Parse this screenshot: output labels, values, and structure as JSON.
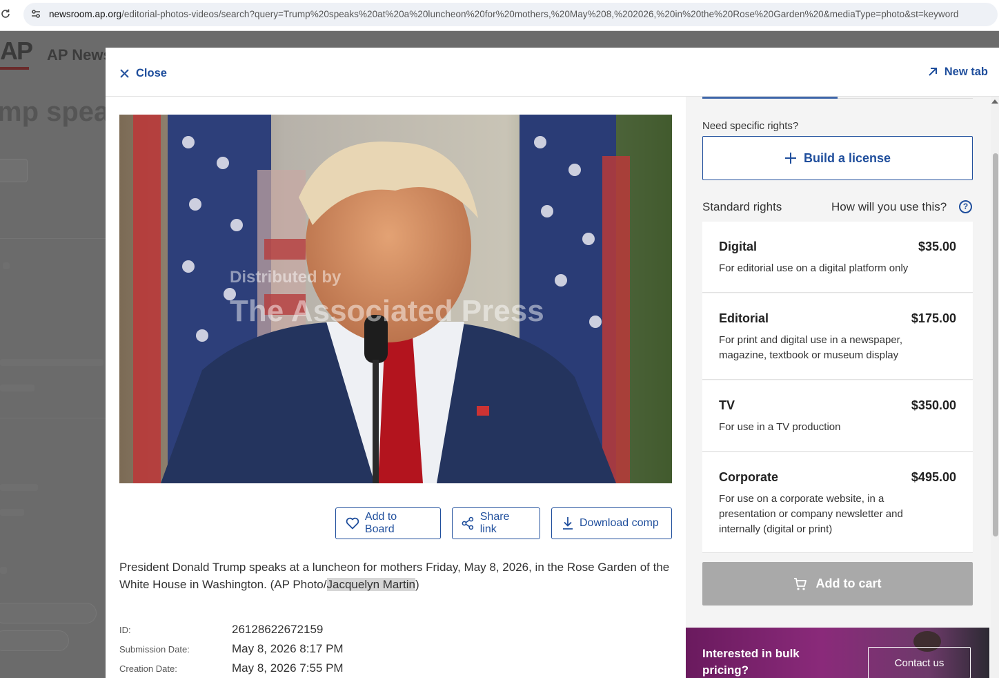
{
  "browser": {
    "url_host": "newsroom.ap.org",
    "url_path": "/editorial-photos-videos/search?query=Trump%20speaks%20at%20a%20luncheon%20for%20mothers,%20May%208,%202026,%20in%20the%20Rose%20Garden%20&mediaType=photo&st=keyword"
  },
  "background": {
    "logo": "AP",
    "brand": "AP News",
    "title_fragment": "mp speak"
  },
  "modal": {
    "close_label": "Close",
    "new_tab_label": "New tab"
  },
  "photo": {
    "watermark_line1": "Distributed by",
    "watermark_line2": "The Associated Press"
  },
  "actions": {
    "add_to_board": "Add to Board",
    "share_link": "Share link",
    "download_comp": "Download comp"
  },
  "caption": {
    "text_before": "President Donald Trump speaks at a luncheon for mothers Friday, May 8, 2026, in the Rose Garden of the White House in Washington. (AP Photo/",
    "photographer": "Jacquelyn Martin",
    "text_after": ")"
  },
  "metadata": [
    {
      "label": "ID:",
      "value": "26128622672159"
    },
    {
      "label": "Submission Date:",
      "value": "May 8, 2026 8:17 PM"
    },
    {
      "label": "Creation Date:",
      "value": "May 8, 2026 7:55 PM"
    }
  ],
  "licensing": {
    "need_specific": "Need specific rights?",
    "build_license": "Build a license",
    "standard_rights": "Standard rights",
    "how_use": "How will you use this?",
    "help_glyph": "?",
    "options": [
      {
        "name": "Digital",
        "price": "$35.00",
        "desc": "For editorial use on a digital platform only"
      },
      {
        "name": "Editorial",
        "price": "$175.00",
        "desc": "For print and digital use in a newspaper, magazine, textbook or museum display"
      },
      {
        "name": "TV",
        "price": "$350.00",
        "desc": "For use in a TV production"
      },
      {
        "name": "Corporate",
        "price": "$495.00",
        "desc": "For use on a corporate website, in a presentation or company newsletter and internally (digital or print)"
      }
    ],
    "add_to_cart": "Add to cart"
  },
  "promo": {
    "text": "Interested in bulk pricing?",
    "contact": "Contact us"
  },
  "colors": {
    "accent": "#1f4e9c",
    "disabled": "#a9a9a9",
    "overlay": "#6b6b6b"
  }
}
